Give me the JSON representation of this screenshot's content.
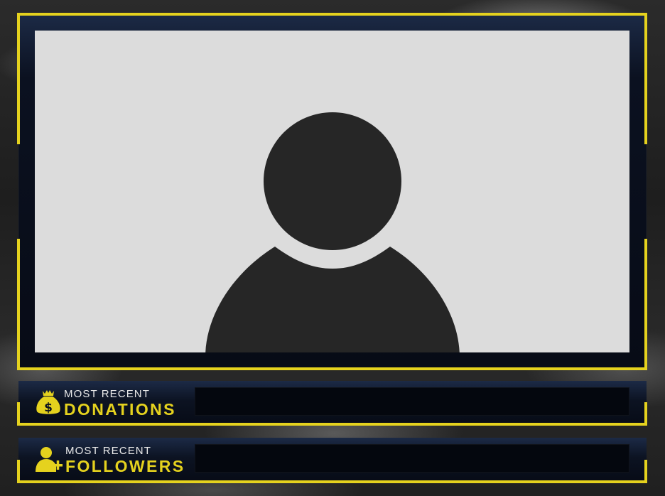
{
  "colors": {
    "accent": "#e5d21e",
    "frame": "#070b16",
    "placeholder": "#dcdcdc",
    "silhouette": "#262626"
  },
  "camera": {
    "icon": "user-silhouette-icon"
  },
  "donations": {
    "label_top": "MOST RECENT",
    "label_main": "DONATIONS",
    "icon": "money-bag-dollar-icon",
    "value": ""
  },
  "followers": {
    "label_top": "MOST RECENT",
    "label_main": "FOLLOWERS",
    "icon": "user-add-icon",
    "value": ""
  }
}
